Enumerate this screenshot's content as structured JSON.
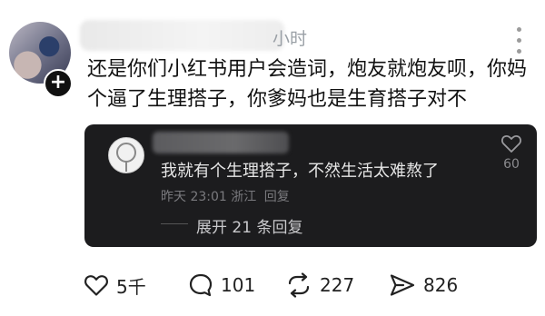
{
  "post": {
    "time": "小时",
    "text": "还是你们小红书用户会造词，炮友就炮友呗，你妈个逼了生理搭子，你爹妈也是生育搭子对不"
  },
  "reply": {
    "text": "我就有个生理搭子，不然生活太难熬了",
    "time": "昨天 23:01",
    "location": "浙江",
    "reply_label": "回复",
    "likes": "60",
    "expand_label": "展开 21 条回复"
  },
  "actions": {
    "like_count": "5千",
    "comment_count": "101",
    "repost_count": "227",
    "share_count": "826"
  },
  "icons": {
    "avatar_badge": "plus-icon",
    "more": "more-vertical-icon",
    "reply_like": "heart-icon",
    "like": "heart-icon",
    "comment": "comment-bubble-icon",
    "repost": "repost-icon",
    "share": "send-icon"
  }
}
